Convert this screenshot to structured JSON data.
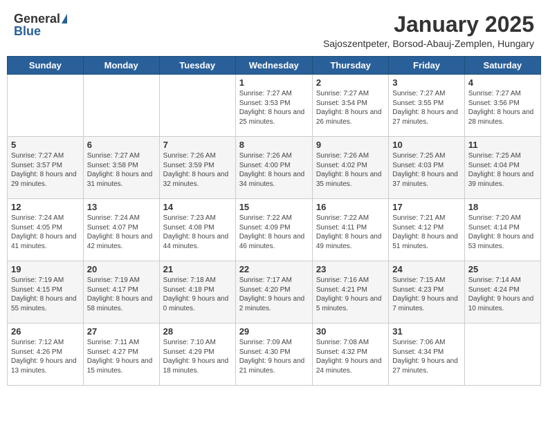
{
  "logo": {
    "general": "General",
    "blue": "Blue"
  },
  "title": {
    "main": "January 2025",
    "sub": "Sajoszentpeter, Borsod-Abauj-Zemplen, Hungary"
  },
  "weekdays": [
    "Sunday",
    "Monday",
    "Tuesday",
    "Wednesday",
    "Thursday",
    "Friday",
    "Saturday"
  ],
  "weeks": [
    [
      {
        "day": "",
        "info": ""
      },
      {
        "day": "",
        "info": ""
      },
      {
        "day": "",
        "info": ""
      },
      {
        "day": "1",
        "info": "Sunrise: 7:27 AM\nSunset: 3:53 PM\nDaylight: 8 hours and 25 minutes."
      },
      {
        "day": "2",
        "info": "Sunrise: 7:27 AM\nSunset: 3:54 PM\nDaylight: 8 hours and 26 minutes."
      },
      {
        "day": "3",
        "info": "Sunrise: 7:27 AM\nSunset: 3:55 PM\nDaylight: 8 hours and 27 minutes."
      },
      {
        "day": "4",
        "info": "Sunrise: 7:27 AM\nSunset: 3:56 PM\nDaylight: 8 hours and 28 minutes."
      }
    ],
    [
      {
        "day": "5",
        "info": "Sunrise: 7:27 AM\nSunset: 3:57 PM\nDaylight: 8 hours and 29 minutes."
      },
      {
        "day": "6",
        "info": "Sunrise: 7:27 AM\nSunset: 3:58 PM\nDaylight: 8 hours and 31 minutes."
      },
      {
        "day": "7",
        "info": "Sunrise: 7:26 AM\nSunset: 3:59 PM\nDaylight: 8 hours and 32 minutes."
      },
      {
        "day": "8",
        "info": "Sunrise: 7:26 AM\nSunset: 4:00 PM\nDaylight: 8 hours and 34 minutes."
      },
      {
        "day": "9",
        "info": "Sunrise: 7:26 AM\nSunset: 4:02 PM\nDaylight: 8 hours and 35 minutes."
      },
      {
        "day": "10",
        "info": "Sunrise: 7:25 AM\nSunset: 4:03 PM\nDaylight: 8 hours and 37 minutes."
      },
      {
        "day": "11",
        "info": "Sunrise: 7:25 AM\nSunset: 4:04 PM\nDaylight: 8 hours and 39 minutes."
      }
    ],
    [
      {
        "day": "12",
        "info": "Sunrise: 7:24 AM\nSunset: 4:05 PM\nDaylight: 8 hours and 41 minutes."
      },
      {
        "day": "13",
        "info": "Sunrise: 7:24 AM\nSunset: 4:07 PM\nDaylight: 8 hours and 42 minutes."
      },
      {
        "day": "14",
        "info": "Sunrise: 7:23 AM\nSunset: 4:08 PM\nDaylight: 8 hours and 44 minutes."
      },
      {
        "day": "15",
        "info": "Sunrise: 7:22 AM\nSunset: 4:09 PM\nDaylight: 8 hours and 46 minutes."
      },
      {
        "day": "16",
        "info": "Sunrise: 7:22 AM\nSunset: 4:11 PM\nDaylight: 8 hours and 49 minutes."
      },
      {
        "day": "17",
        "info": "Sunrise: 7:21 AM\nSunset: 4:12 PM\nDaylight: 8 hours and 51 minutes."
      },
      {
        "day": "18",
        "info": "Sunrise: 7:20 AM\nSunset: 4:14 PM\nDaylight: 8 hours and 53 minutes."
      }
    ],
    [
      {
        "day": "19",
        "info": "Sunrise: 7:19 AM\nSunset: 4:15 PM\nDaylight: 8 hours and 55 minutes."
      },
      {
        "day": "20",
        "info": "Sunrise: 7:19 AM\nSunset: 4:17 PM\nDaylight: 8 hours and 58 minutes."
      },
      {
        "day": "21",
        "info": "Sunrise: 7:18 AM\nSunset: 4:18 PM\nDaylight: 9 hours and 0 minutes."
      },
      {
        "day": "22",
        "info": "Sunrise: 7:17 AM\nSunset: 4:20 PM\nDaylight: 9 hours and 2 minutes."
      },
      {
        "day": "23",
        "info": "Sunrise: 7:16 AM\nSunset: 4:21 PM\nDaylight: 9 hours and 5 minutes."
      },
      {
        "day": "24",
        "info": "Sunrise: 7:15 AM\nSunset: 4:23 PM\nDaylight: 9 hours and 7 minutes."
      },
      {
        "day": "25",
        "info": "Sunrise: 7:14 AM\nSunset: 4:24 PM\nDaylight: 9 hours and 10 minutes."
      }
    ],
    [
      {
        "day": "26",
        "info": "Sunrise: 7:12 AM\nSunset: 4:26 PM\nDaylight: 9 hours and 13 minutes."
      },
      {
        "day": "27",
        "info": "Sunrise: 7:11 AM\nSunset: 4:27 PM\nDaylight: 9 hours and 15 minutes."
      },
      {
        "day": "28",
        "info": "Sunrise: 7:10 AM\nSunset: 4:29 PM\nDaylight: 9 hours and 18 minutes."
      },
      {
        "day": "29",
        "info": "Sunrise: 7:09 AM\nSunset: 4:30 PM\nDaylight: 9 hours and 21 minutes."
      },
      {
        "day": "30",
        "info": "Sunrise: 7:08 AM\nSunset: 4:32 PM\nDaylight: 9 hours and 24 minutes."
      },
      {
        "day": "31",
        "info": "Sunrise: 7:06 AM\nSunset: 4:34 PM\nDaylight: 9 hours and 27 minutes."
      },
      {
        "day": "",
        "info": ""
      }
    ]
  ]
}
